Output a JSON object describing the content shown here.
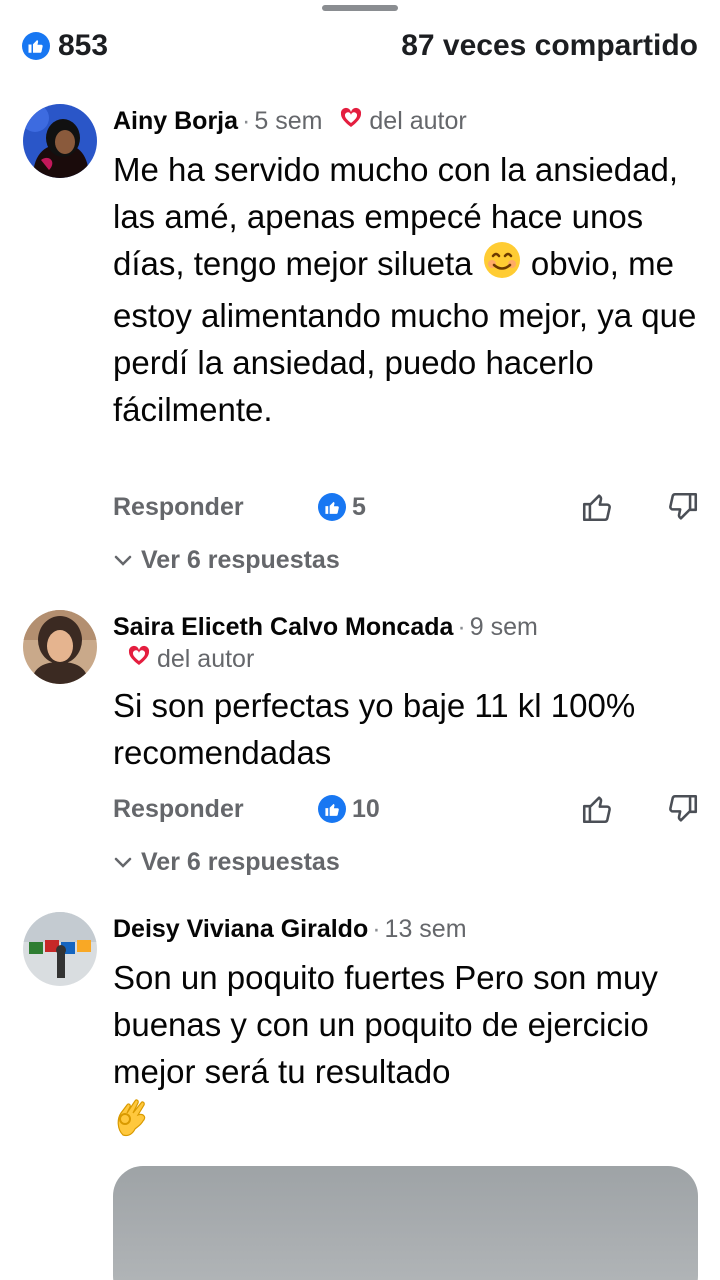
{
  "stats": {
    "likes": "853",
    "shares": "87 veces compartido"
  },
  "comments": [
    {
      "author": "Ainy Borja",
      "time": "5 sem",
      "author_like": "del autor",
      "text": "Me ha servido mucho con la ansiedad, las amé, apenas empecé hace unos días, tengo mejor silueta",
      "text_after_emoji": "obvio, me estoy alimentando mucho mejor, ya que perdí la ansiedad, puedo hacerlo fácilmente.",
      "reply_label": "Responder",
      "reaction_count": "5",
      "replies_label": "Ver 6 respuestas"
    },
    {
      "author": "Saira Eliceth Calvo Moncada",
      "time": "9 sem",
      "author_like": "del autor",
      "text": "Si son perfectas yo baje 11 kl 100% recomendadas",
      "reply_label": "Responder",
      "reaction_count": "10",
      "replies_label": "Ver 6 respuestas"
    },
    {
      "author": "Deisy Viviana Giraldo",
      "time": "13 sem",
      "text": "Son un poquito fuertes Pero son muy buenas y con un poquito de ejercicio mejor será tu resultado"
    }
  ],
  "icons": {
    "like_badge": "thumbs-up-badge-icon",
    "heart": "heart-icon",
    "thumb_up": "thumb-up-outline-icon",
    "thumb_down": "thumb-down-outline-icon",
    "chevron": "chevron-down-icon",
    "smile_emoji": "smiling-face-emoji",
    "ok_emoji": "ok-hand-emoji"
  },
  "colors": {
    "accent": "#1877f2",
    "heart": "#e41e3f",
    "muted": "#65676b"
  }
}
